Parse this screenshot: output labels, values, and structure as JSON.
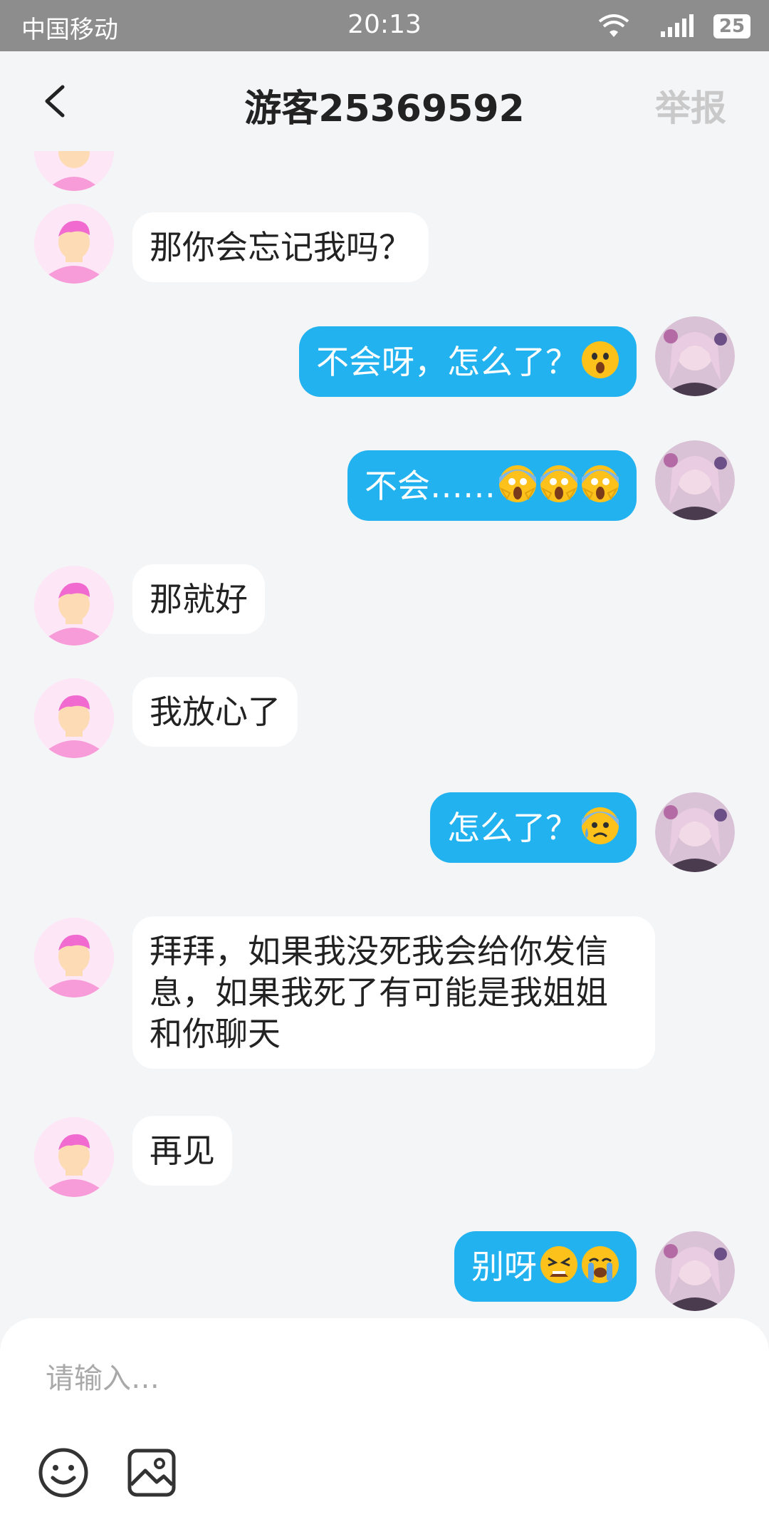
{
  "status_bar": {
    "carrier": "中国移动",
    "time": "20:13",
    "battery": "25"
  },
  "header": {
    "title": "游客25369592",
    "report_label": "举报"
  },
  "messages": [
    {
      "side": "left",
      "text": "那你会忘记我吗？"
    },
    {
      "side": "right",
      "text": "不会呀，怎么了？",
      "emojis": [
        "astonished-face"
      ]
    },
    {
      "side": "right",
      "text": "不会……",
      "emojis": [
        "scream-face",
        "scream-face",
        "scream-face"
      ]
    },
    {
      "side": "left",
      "text": "那就好"
    },
    {
      "side": "left",
      "text": "我放心了"
    },
    {
      "side": "right",
      "text": "怎么了？",
      "emojis": [
        "anxious-sweat-face"
      ]
    },
    {
      "side": "left",
      "text": "拜拜，如果我没死我会给你发信息，如果我死了有可能是我姐姐和你聊天"
    },
    {
      "side": "left",
      "text": "再见"
    },
    {
      "side": "right",
      "text": "别呀",
      "emojis": [
        "tired-face",
        "crying-face"
      ]
    }
  ],
  "input": {
    "placeholder": "请输入…"
  },
  "colors": {
    "accent": "#22b2f0",
    "background": "#f4f5f7",
    "status_bar": "#8d8d8d",
    "avatar_pink": "#f79bd9"
  }
}
